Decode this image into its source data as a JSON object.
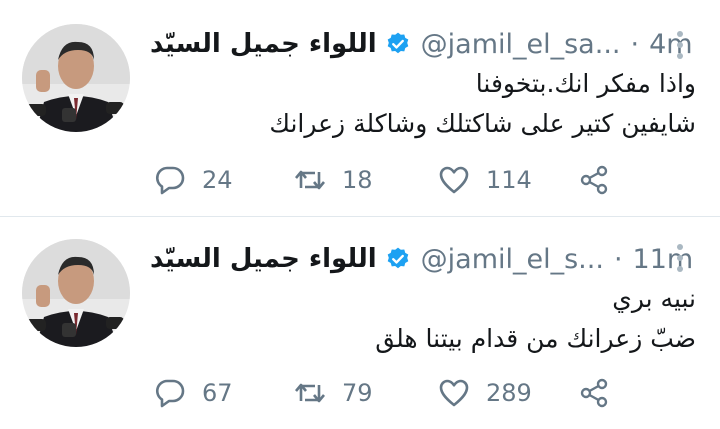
{
  "tweets": [
    {
      "author_name": "اللواء جميل السيّد",
      "handle": "@jamil_el_sa...",
      "separator": "·",
      "time": "4m",
      "lines": [
        "واذا مفكر انك.بتخوفنا",
        "شايفين كتير على شاكتلك وشاكلة زعرانك"
      ],
      "replies": "24",
      "retweets": "18",
      "likes": "114"
    },
    {
      "author_name": "اللواء جميل السيّد",
      "handle": "@jamil_el_s...",
      "separator": "·",
      "time": "11m",
      "lines": [
        "نبيه بري",
        "ضبّ زعرانك من قدام بيتنا هلق"
      ],
      "replies": "67",
      "retweets": "79",
      "likes": "289"
    }
  ],
  "icons": {
    "verified": "verified-badge-icon",
    "caret": "more-options-icon",
    "reply": "reply-icon",
    "retweet": "retweet-icon",
    "like": "heart-icon",
    "share": "share-icon"
  },
  "colors": {
    "verified": "#1da1f2",
    "muted": "#657786",
    "divider": "#e1e8ed"
  }
}
